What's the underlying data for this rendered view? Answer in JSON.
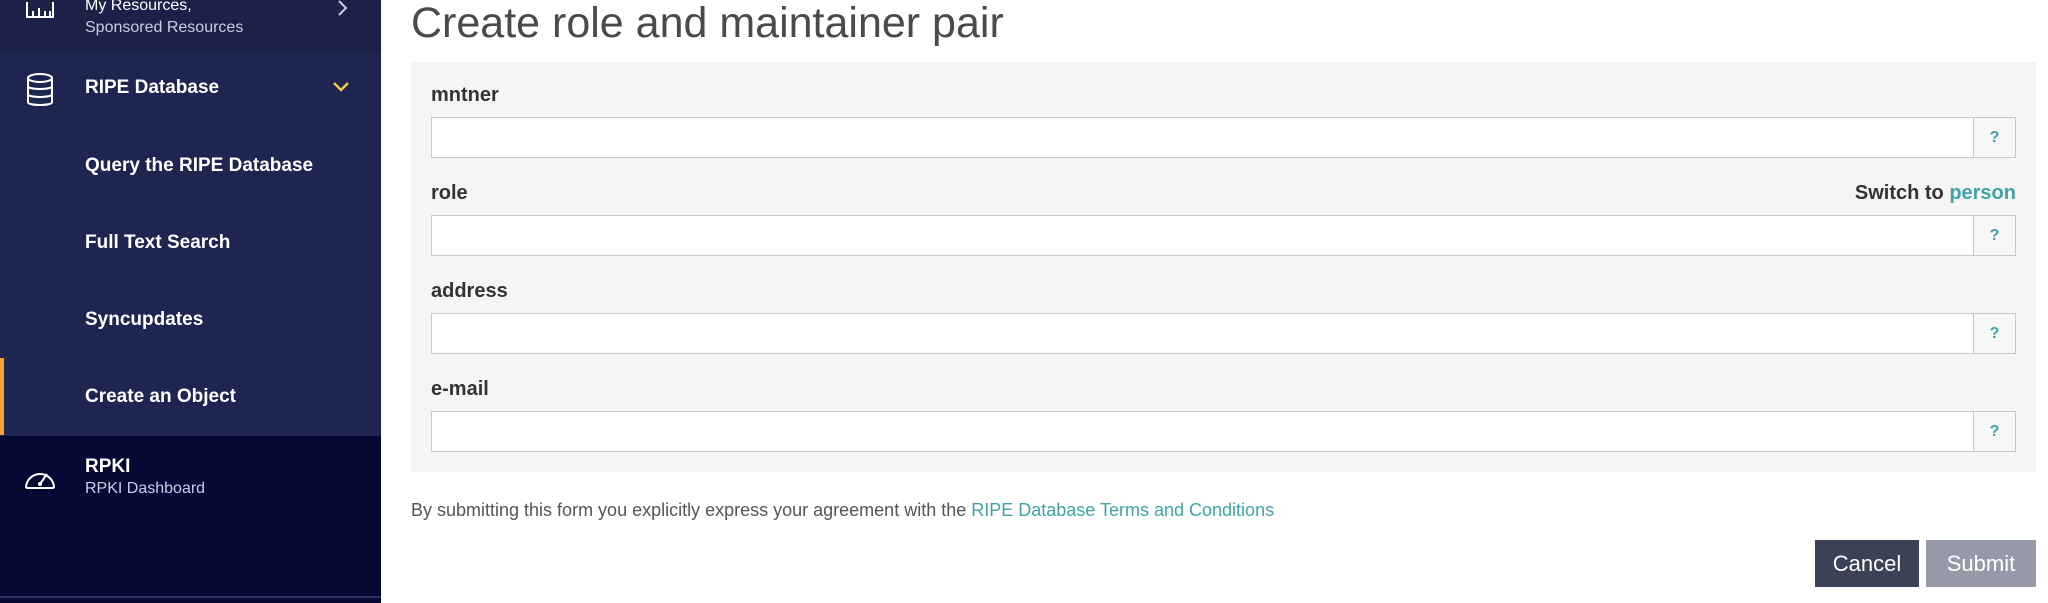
{
  "sidebar": {
    "resources": {
      "title": "My Resources,",
      "subtitle": "Sponsored Resources"
    },
    "ripe_database": {
      "title": "RIPE Database",
      "items": [
        {
          "label": "Query the RIPE Database"
        },
        {
          "label": "Full Text Search"
        },
        {
          "label": "Syncupdates"
        },
        {
          "label": "Create an Object"
        }
      ]
    },
    "rpki": {
      "title": "RPKI",
      "subtitle": "RPKI Dashboard"
    }
  },
  "main": {
    "title": "Create role and maintainer pair",
    "fields": [
      {
        "label": "mntner",
        "value": ""
      },
      {
        "label": "role",
        "value": ""
      },
      {
        "label": "address",
        "value": ""
      },
      {
        "label": "e-mail",
        "value": ""
      }
    ],
    "help_label": "?",
    "switch": {
      "prefix": "Switch to",
      "link": "person"
    },
    "terms": {
      "text": "By submitting this form you explicitly express your agreement with the",
      "link": "RIPE Database Terms and Conditions"
    },
    "buttons": {
      "cancel": "Cancel",
      "submit": "Submit"
    }
  },
  "colors": {
    "sidebar_bg": "#050a34",
    "submenu_bg": "#1f2551",
    "active_indicator": "#f3a33a",
    "chevron": "#f3c842",
    "link": "#3fa3a8",
    "cancel_bg": "#3c4256",
    "submit_bg": "#969aa8"
  }
}
